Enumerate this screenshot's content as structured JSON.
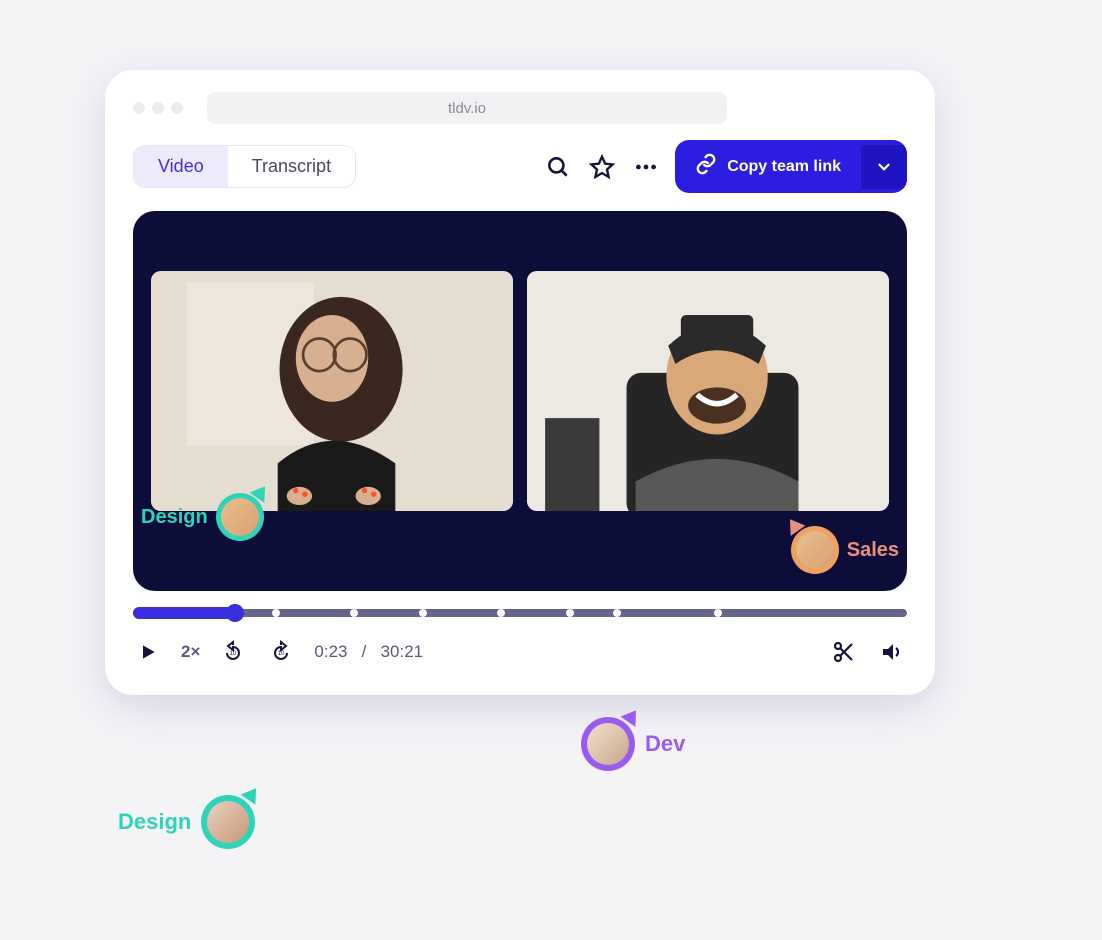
{
  "browser": {
    "url": "tldv.io"
  },
  "tabs": {
    "video": "Video",
    "transcript": "Transcript"
  },
  "actions": {
    "copy_team_link": "Copy team link"
  },
  "player": {
    "speed": "2×",
    "current": "0:23",
    "total": "30:21",
    "separator": "/",
    "progress_pct": 13
  },
  "cursors": {
    "design": "Design",
    "sales": "Sales",
    "dev": "Dev",
    "design2": "Design"
  },
  "colors": {
    "primary": "#2b1ee0",
    "design": "#2fd4b8",
    "sales": "#e89080",
    "dev": "#9a5cf0"
  }
}
